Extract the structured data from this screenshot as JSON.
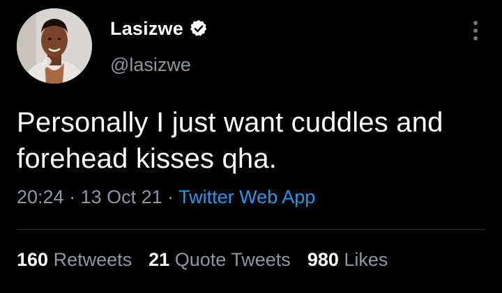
{
  "author": {
    "display_name": "Lasizwe",
    "handle": "@lasizwe",
    "verified_icon": "verified-badge-icon"
  },
  "tweet": {
    "text_line1": "Personally I just want cuddles and",
    "text_line2": "forehead kisses qha."
  },
  "meta": {
    "time": "20:24",
    "separator": " · ",
    "date": "13 Oct 21",
    "source": "Twitter Web App"
  },
  "stats": {
    "retweets_count": "160",
    "retweets_label": "Retweets",
    "quotes_count": "21",
    "quotes_label": "Quote Tweets",
    "likes_count": "980",
    "likes_label": "Likes"
  },
  "colors": {
    "background": "#000000",
    "text_primary": "#ffffff",
    "text_secondary": "#8b98a5",
    "link": "#1d9bf0",
    "divider": "#2f3336"
  }
}
